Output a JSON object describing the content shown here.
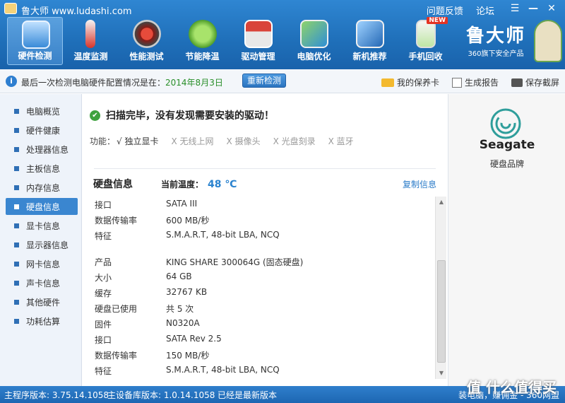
{
  "app": {
    "title": "鲁大师 www.ludashi.com",
    "links": [
      "问题反馈",
      "论坛"
    ],
    "controls": [
      "☰",
      "—",
      "✕"
    ]
  },
  "nav": [
    {
      "label": "硬件检测",
      "icon": "monitor-magnifier-icon",
      "active": true
    },
    {
      "label": "温度监测",
      "icon": "thermometer-icon"
    },
    {
      "label": "性能测试",
      "icon": "speedometer-icon"
    },
    {
      "label": "节能降温",
      "icon": "clover-icon"
    },
    {
      "label": "驱动管理",
      "icon": "driver-box-icon"
    },
    {
      "label": "电脑优化",
      "icon": "optimize-monitor-icon"
    },
    {
      "label": "新机推荐",
      "icon": "new-pc-icon"
    },
    {
      "label": "手机回收",
      "icon": "phone-recycle-icon",
      "badge": "NEW"
    }
  ],
  "brand": {
    "name": "鲁大师",
    "tagline": "360旗下安全产品"
  },
  "infobar": {
    "text": "最后一次检测电脑硬件配置情况是在：",
    "date": "2014年8月3日",
    "redetect": "重新检测",
    "tools": [
      "我的保养卡",
      "生成报告",
      "保存截屏"
    ]
  },
  "sidebar": {
    "items": [
      "电脑概览",
      "硬件健康",
      "处理器信息",
      "主板信息",
      "内存信息",
      "硬盘信息",
      "显卡信息",
      "显示器信息",
      "网卡信息",
      "声卡信息",
      "其他硬件",
      "功耗估算"
    ],
    "active_index": 5
  },
  "main": {
    "scan_result": "扫描完毕，没有发现需要安装的驱动！",
    "features_label": "功能：",
    "features": [
      {
        "label": "√ 独立显卡",
        "ok": true
      },
      {
        "label": "X 无线上网",
        "ok": false
      },
      {
        "label": "X 摄像头",
        "ok": false
      },
      {
        "label": "X 光盘刻录",
        "ok": false
      },
      {
        "label": "X 蓝牙",
        "ok": false
      }
    ],
    "panel_title": "硬盘信息",
    "temp_label": "当前温度：",
    "temp_value": "48 ℃",
    "copy_info": "复制信息",
    "rows": [
      {
        "k": "接口",
        "v": "SATA III"
      },
      {
        "k": "数据传输率",
        "v": "600 MB/秒"
      },
      {
        "k": "特征",
        "v": "S.M.A.R.T,  48-bit LBA,  NCQ"
      },
      {
        "k": "",
        "v": ""
      },
      {
        "k": "产品",
        "v": "KING SHARE 300064G (固态硬盘)"
      },
      {
        "k": "大小",
        "v": "64 GB"
      },
      {
        "k": "缓存",
        "v": "32767 KB"
      },
      {
        "k": "硬盘已使用",
        "v": "共 5 次"
      },
      {
        "k": "固件",
        "v": "N0320A"
      },
      {
        "k": "接口",
        "v": "SATA Rev 2.5"
      },
      {
        "k": "数据传输率",
        "v": "150 MB/秒"
      },
      {
        "k": "特征",
        "v": "S.M.A.R.T,  48-bit LBA,  NCQ"
      }
    ]
  },
  "right_panel": {
    "logo_text": "Seagate",
    "label": "硬盘品牌"
  },
  "status": {
    "main_version": "主程序版本: 3.75.14.1058",
    "db_version": "主设备库版本: 1.0.14.1058",
    "latest": "已经是最新版本",
    "right": "装电脑，赚佣金 - 360网盟",
    "watermark": "值 什么值得买"
  }
}
